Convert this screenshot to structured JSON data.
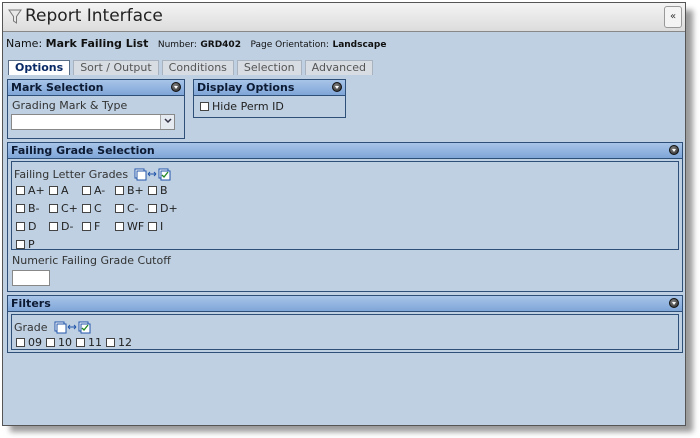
{
  "window": {
    "title": "Report Interface"
  },
  "namebar": {
    "name_label": "Name:",
    "name_value": "Mark Failing List",
    "number_label": "Number:",
    "number_value": "GRD402",
    "orientation_label": "Page Orientation:",
    "orientation_value": "Landscape"
  },
  "tabs": [
    {
      "label": "Options",
      "active": true
    },
    {
      "label": "Sort / Output"
    },
    {
      "label": "Conditions"
    },
    {
      "label": "Selection"
    },
    {
      "label": "Advanced"
    }
  ],
  "mark_selection": {
    "header": "Mark Selection",
    "grading_label": "Grading Mark & Type",
    "grading_value": ""
  },
  "display_options": {
    "header": "Display Options",
    "hide_perm_id": "Hide Perm ID"
  },
  "failing_grade_selection": {
    "header": "Failing Grade Selection",
    "letter_label": "Failing Letter Grades",
    "grades": [
      "A+",
      "A",
      "A-",
      "B+",
      "B",
      "B-",
      "C+",
      "C",
      "C-",
      "D+",
      "D",
      "D-",
      "F",
      "WF",
      "I",
      "P"
    ],
    "numeric_label": "Numeric Failing Grade Cutoff",
    "numeric_value": ""
  },
  "filters": {
    "header": "Filters",
    "grade_label": "Grade",
    "grades": [
      "09",
      "10",
      "11",
      "12"
    ]
  }
}
